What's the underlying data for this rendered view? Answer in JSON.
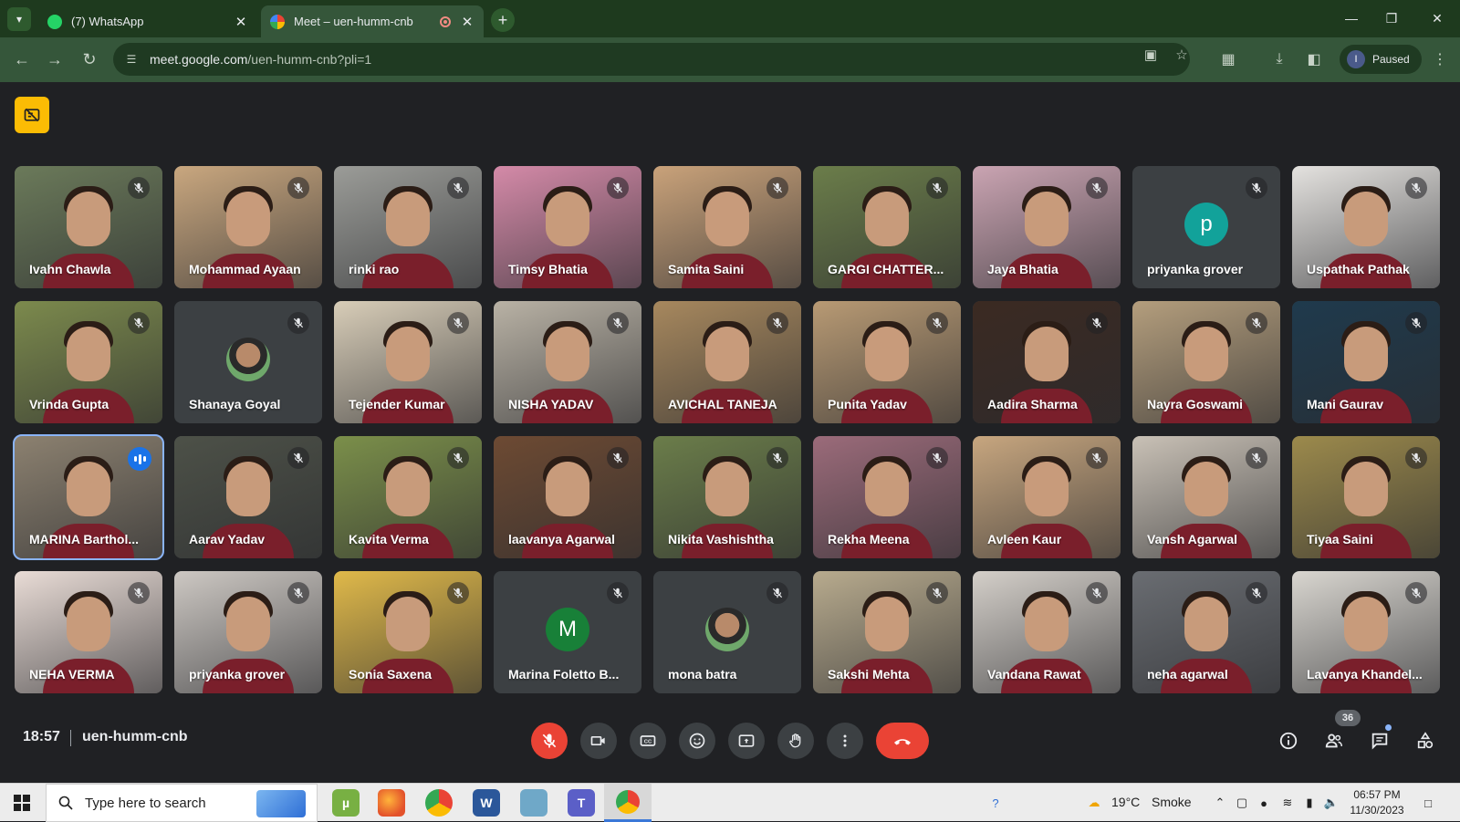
{
  "browser": {
    "tabs": [
      {
        "title": "(7) WhatsApp",
        "favicon_color": "#25d366",
        "active": false
      },
      {
        "title": "Meet – uen-humm-cnb",
        "favicon_color": "#34a853",
        "active": true
      }
    ],
    "url_host": "meet.google.com",
    "url_path": "/uen-humm-cnb?pli=1",
    "profile_initial": "I",
    "profile_status": "Paused",
    "icons": {
      "tab_menu": "chevron-down-icon",
      "back": "arrow-left-icon",
      "forward": "arrow-right-icon",
      "reload": "reload-icon",
      "site_info": "tune-icon",
      "camera": "camera-icon",
      "bookmark": "star-icon",
      "extensions": "puzzle-icon",
      "download": "download-icon",
      "side_panel": "side-panel-icon",
      "menu": "kebab-icon"
    }
  },
  "meet": {
    "meeting_code": "uen-humm-cnb",
    "time": "18:57",
    "participant_count": "36",
    "participants": [
      {
        "name": "Ivahn Chawla",
        "type": "video",
        "bg": "#6b7a5a"
      },
      {
        "name": "Mohammad Ayaan",
        "type": "video",
        "bg": "#c9a77f"
      },
      {
        "name": "rinki rao",
        "type": "video",
        "bg": "#9b9c98"
      },
      {
        "name": "Timsy Bhatia",
        "type": "video",
        "bg": "#d48aa8"
      },
      {
        "name": "Samita Saini",
        "type": "video",
        "bg": "#c9a27a"
      },
      {
        "name": "GARGI CHATTER...",
        "type": "video",
        "bg": "#6b7d4a"
      },
      {
        "name": "Jaya Bhatia",
        "type": "video",
        "bg": "#caa4b2"
      },
      {
        "name": "priyanka grover",
        "type": "letter",
        "letter": "p",
        "avatar_color": "#12a29a"
      },
      {
        "name": "Uspathak Pathak",
        "type": "video",
        "bg": "#e4e2df"
      },
      {
        "name": "Vrinda Gupta",
        "type": "video",
        "bg": "#7c8a4d"
      },
      {
        "name": "Shanaya Goyal",
        "type": "photo"
      },
      {
        "name": "Tejender Kumar",
        "type": "video",
        "bg": "#d8cdb8"
      },
      {
        "name": "NISHA YADAV",
        "type": "video",
        "bg": "#b9b2a5"
      },
      {
        "name": "AVICHAL TANEJA",
        "type": "video",
        "bg": "#a7885e"
      },
      {
        "name": "Punita Yadav",
        "type": "video",
        "bg": "#b89a74"
      },
      {
        "name": "Aadira Sharma",
        "type": "video",
        "bg": "#3b2a22"
      },
      {
        "name": "Nayra Goswami",
        "type": "video",
        "bg": "#b49e7d"
      },
      {
        "name": "Mani Gaurav",
        "type": "video",
        "bg": "#1f3a4d"
      },
      {
        "name": "MARINA Barthol...",
        "type": "video",
        "bg": "#8c8170",
        "speaking": true
      },
      {
        "name": "Aarav Yadav",
        "type": "video",
        "bg": "#4d5148"
      },
      {
        "name": "Kavita Verma",
        "type": "video",
        "bg": "#7b8f4a"
      },
      {
        "name": "laavanya Agarwal",
        "type": "video",
        "bg": "#6d4a33"
      },
      {
        "name": "Nikita Vashishtha",
        "type": "video",
        "bg": "#6b7d4a"
      },
      {
        "name": "Rekha Meena",
        "type": "video",
        "bg": "#9b6b7a"
      },
      {
        "name": "Avleen Kaur",
        "type": "video",
        "bg": "#c7a67f"
      },
      {
        "name": "Vansh Agarwal",
        "type": "video",
        "bg": "#c9c1b6"
      },
      {
        "name": "Tiyaa Saini",
        "type": "video",
        "bg": "#9c8a4c"
      },
      {
        "name": "NEHA VERMA",
        "type": "video",
        "bg": "#e9dcd6"
      },
      {
        "name": "priyanka grover",
        "type": "video",
        "bg": "#cdc8c3"
      },
      {
        "name": "Sonia Saxena",
        "type": "video",
        "bg": "#e0b94a"
      },
      {
        "name": "Marina Foletto B...",
        "type": "letter",
        "letter": "M",
        "avatar_color": "#188038"
      },
      {
        "name": "mona batra",
        "type": "photo"
      },
      {
        "name": "Sakshi Mehta",
        "type": "video",
        "bg": "#b8ab8e"
      },
      {
        "name": "Vandana Rawat",
        "type": "video",
        "bg": "#d4cfc9"
      },
      {
        "name": "neha agarwal",
        "type": "video",
        "bg": "#6a6d72"
      },
      {
        "name": "Lavanya Khandel...",
        "type": "video",
        "bg": "#d9d6d0"
      }
    ],
    "controls": [
      {
        "name": "mic-off",
        "icon": "mic-off-icon",
        "danger": true
      },
      {
        "name": "camera",
        "icon": "video-icon"
      },
      {
        "name": "captions",
        "icon": "captions-icon"
      },
      {
        "name": "reactions",
        "icon": "emoji-icon"
      },
      {
        "name": "present",
        "icon": "present-screen-icon"
      },
      {
        "name": "raise-hand",
        "icon": "hand-icon"
      },
      {
        "name": "more-options",
        "icon": "kebab-icon"
      }
    ],
    "end_call_icon": "call-end-icon",
    "right_controls": [
      "info-icon",
      "people-icon",
      "chat-icon",
      "activities-icon"
    ]
  },
  "taskbar": {
    "search_placeholder": "Type here to search",
    "weather_temp": "19°C",
    "weather_desc": "Smoke",
    "time": "06:57 PM",
    "date": "11/30/2023",
    "apps": [
      "windows-start-icon",
      "utorrent-icon",
      "firefox-icon",
      "chrome-icon",
      "word-icon",
      "notepad-icon",
      "teams-icon",
      "chrome-active-icon"
    ]
  },
  "colors": {
    "tabbar_bg": "#1e3a1e",
    "toolbar_bg": "#35563a",
    "meet_bg": "#202124",
    "tile_bg": "#3c4043",
    "danger": "#ea4335",
    "speaking_outline": "#8ab4f8",
    "recording_badge": "#fbbc04"
  }
}
